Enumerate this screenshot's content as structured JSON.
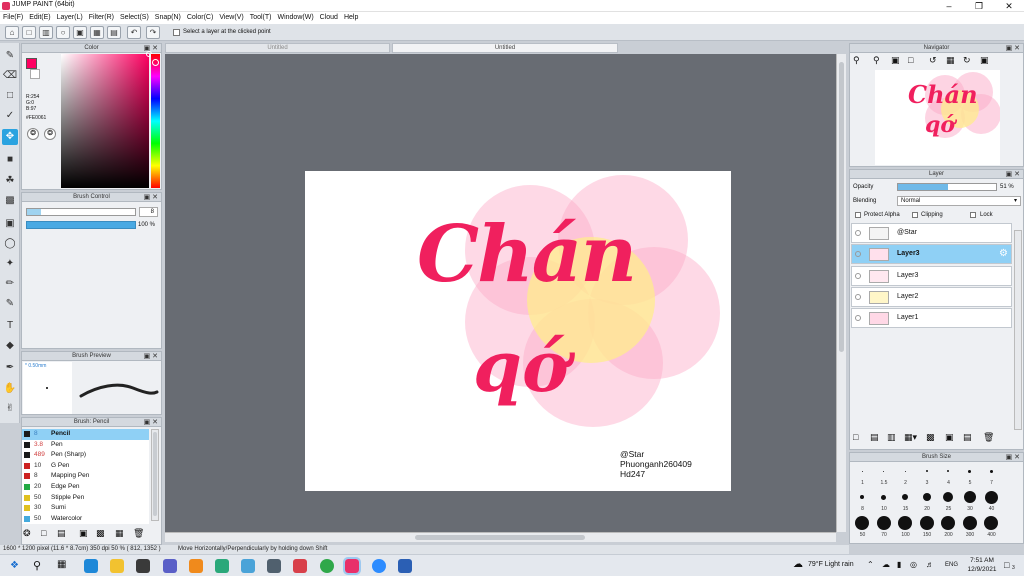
{
  "window": {
    "title": "JUMP PAINT (64bit)"
  },
  "menu": [
    "File(F)",
    "Edit(E)",
    "Layer(L)",
    "Filter(R)",
    "Select(S)",
    "Snap(N)",
    "Color(C)",
    "View(V)",
    "Tool(T)",
    "Window(W)",
    "Cloud",
    "Help"
  ],
  "toolbar": {
    "select_layer_label": "Select a layer at the clicked point"
  },
  "tabs": [
    "Untitled",
    "Untitled"
  ],
  "color_panel": {
    "title": "Color",
    "r": "R:254",
    "g": "G:0",
    "b": "B:97",
    "hex": "#FE0061",
    "accent": "#fe0061"
  },
  "brush_control": {
    "title": "Brush Control",
    "size": "8",
    "opacity": "100 %"
  },
  "brush_preview": {
    "title": "Brush Preview",
    "size_label": "* 0.50mm"
  },
  "brush_list": {
    "title": "Brush: Pencil",
    "items": [
      {
        "size": "8",
        "name": "Pencil",
        "color": "#1a1a1a"
      },
      {
        "size": "3.8",
        "name": "Pen",
        "color": "#1a1a1a"
      },
      {
        "size": "489",
        "name": "Pen (Sharp)",
        "color": "#1a1a1a"
      },
      {
        "size": "10",
        "name": "G Pen",
        "color": "#cc2222"
      },
      {
        "size": "8",
        "name": "Mapping Pen",
        "color": "#cc2222"
      },
      {
        "size": "20",
        "name": "Edge Pen",
        "color": "#22aa44"
      },
      {
        "size": "50",
        "name": "Stipple Pen",
        "color": "#e0c020"
      },
      {
        "size": "30",
        "name": "Sumi",
        "color": "#e0c020"
      },
      {
        "size": "50",
        "name": "Watercolor",
        "color": "#44aadd"
      }
    ]
  },
  "canvas": {
    "line1": "Chán",
    "line2": "qớ",
    "credit1": "@Star",
    "credit2": "Phuonganh260409",
    "credit3": "Hd247"
  },
  "navigator": {
    "title": "Navigator"
  },
  "layer_panel": {
    "title": "Layer",
    "opacity_label": "Opacity",
    "opacity_value": "51 %",
    "opacity_fraction": 0.51,
    "blending_label": "Blending",
    "blending_value": "Normal",
    "protect_alpha": "Protect Alpha",
    "clipping": "Clipping",
    "lock": "Lock",
    "layers": [
      "@Star",
      "Layer3",
      "Layer3",
      "Layer2",
      "Layer1"
    ],
    "selected_index": 1
  },
  "brush_size": {
    "title": "Brush Size",
    "row1": [
      "1",
      "1.5",
      "2",
      "3",
      "4",
      "5",
      "7"
    ],
    "row2": [
      "8",
      "10",
      "15",
      "20",
      "25",
      "30",
      "40"
    ],
    "row3": [
      "50",
      "70",
      "100",
      "150",
      "200",
      "300",
      "400"
    ]
  },
  "status": {
    "dims": "1600 * 1200 pixel   (11.6 * 8.7cm)   350 dpi   50 %   ( 812, 1352 )",
    "hint": "Move Horizontally/Perpendicularly by holding down Shift"
  },
  "taskbar": {
    "weather": "79°F  Light rain",
    "lang": "ENG",
    "time": "7:51 AM",
    "date": "12/9/2021",
    "notif": "3"
  }
}
